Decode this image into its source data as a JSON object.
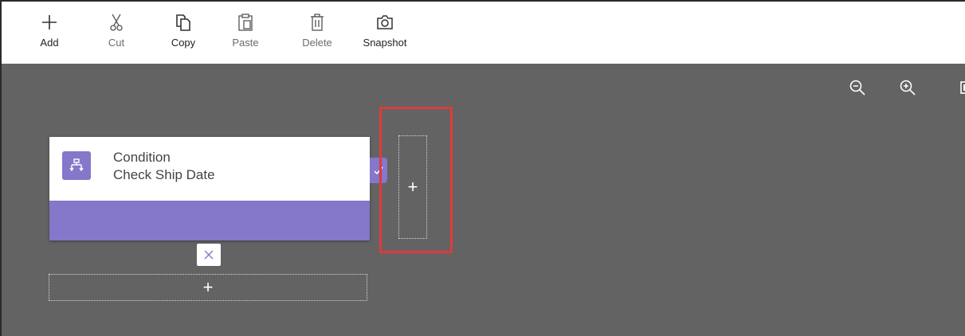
{
  "toolbar": {
    "buttons": [
      {
        "label": "Add",
        "icon": "plus-icon",
        "enabled": true
      },
      {
        "label": "Cut",
        "icon": "scissors-icon",
        "enabled": false
      },
      {
        "label": "Copy",
        "icon": "copy-icon",
        "enabled": true
      },
      {
        "label": "Paste",
        "icon": "clipboard-icon",
        "enabled": false
      },
      {
        "label": "Delete",
        "icon": "trash-icon",
        "enabled": false
      },
      {
        "label": "Snapshot",
        "icon": "camera-icon",
        "enabled": true
      }
    ]
  },
  "canvas": {
    "background": "#636363",
    "zoom_controls": [
      "zoom-out-icon",
      "zoom-in-icon",
      "fit-to-screen-icon"
    ],
    "condition_card": {
      "type_label": "Condition",
      "name": "Check Ship Date",
      "accent_color": "#8577c9",
      "icon": "condition-branch-icon"
    },
    "add_below_label": "+",
    "add_right_label": "+",
    "highlight_color": "#e03a3a"
  }
}
